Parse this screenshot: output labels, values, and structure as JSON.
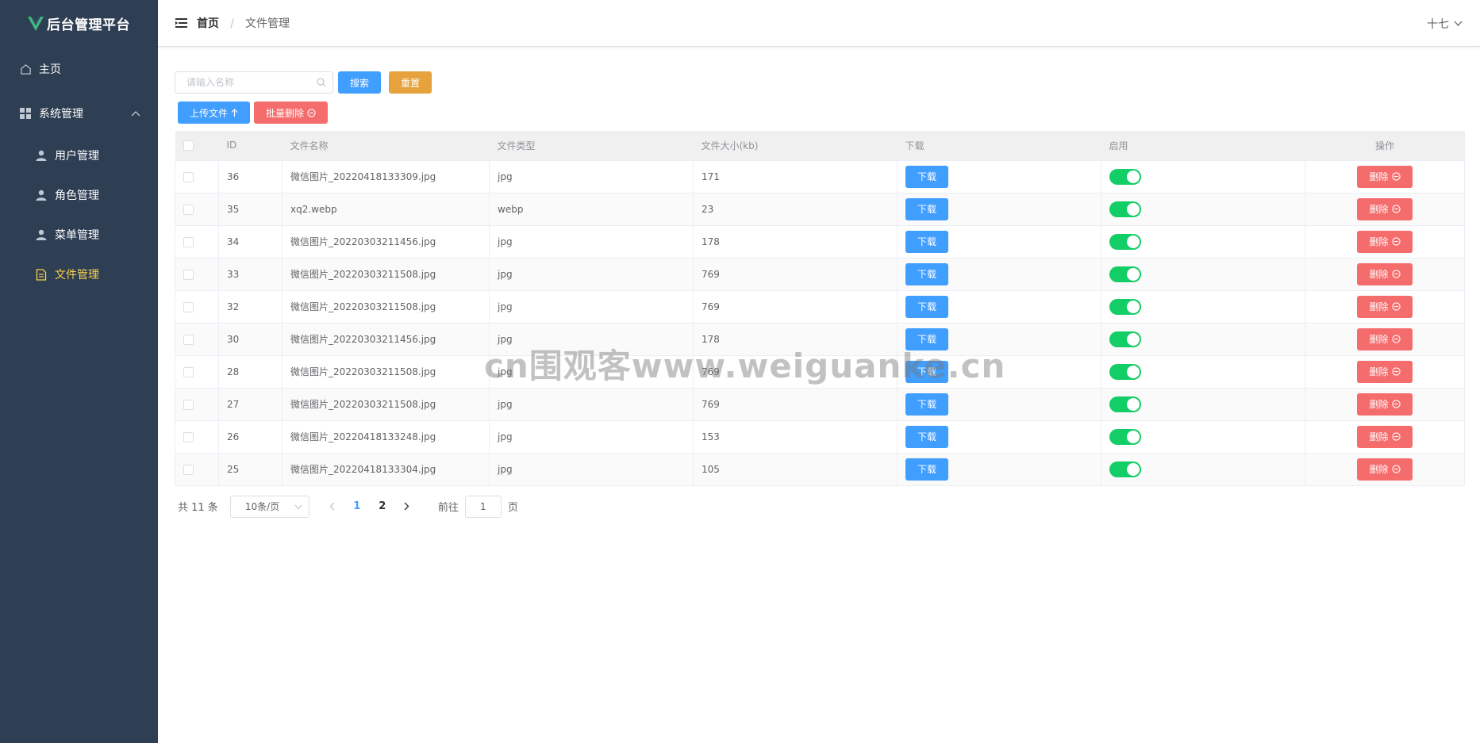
{
  "app": {
    "title": "后台管理平台"
  },
  "sidebar": {
    "items": [
      {
        "label": "主页",
        "icon": "home-icon"
      },
      {
        "label": "系统管理",
        "icon": "grid-icon",
        "expanded": true
      }
    ],
    "subitems": [
      {
        "label": "用户管理",
        "icon": "user-icon"
      },
      {
        "label": "角色管理",
        "icon": "user-icon"
      },
      {
        "label": "菜单管理",
        "icon": "user-icon"
      },
      {
        "label": "文件管理",
        "icon": "document-icon",
        "active": true
      }
    ]
  },
  "header": {
    "breadcrumb": {
      "home": "首页",
      "separator": "/",
      "current": "文件管理"
    },
    "user": "十七"
  },
  "toolbar": {
    "search_placeholder": "请输入名称",
    "search_label": "搜索",
    "reset_label": "重置",
    "upload_label": "上传文件",
    "batch_delete_label": "批量删除"
  },
  "table": {
    "columns": [
      "ID",
      "文件名称",
      "文件类型",
      "文件大小(kb)",
      "下载",
      "启用",
      "操作"
    ],
    "download_label": "下载",
    "delete_label": "删除",
    "rows": [
      {
        "id": "36",
        "name": "微信图片_20220418133309.jpg",
        "type": "jpg",
        "size": "171",
        "enabled": true
      },
      {
        "id": "35",
        "name": "xq2.webp",
        "type": "webp",
        "size": "23",
        "enabled": true
      },
      {
        "id": "34",
        "name": "微信图片_20220303211456.jpg",
        "type": "jpg",
        "size": "178",
        "enabled": true
      },
      {
        "id": "33",
        "name": "微信图片_20220303211508.jpg",
        "type": "jpg",
        "size": "769",
        "enabled": true
      },
      {
        "id": "32",
        "name": "微信图片_20220303211508.jpg",
        "type": "jpg",
        "size": "769",
        "enabled": true
      },
      {
        "id": "30",
        "name": "微信图片_20220303211456.jpg",
        "type": "jpg",
        "size": "178",
        "enabled": true
      },
      {
        "id": "28",
        "name": "微信图片_20220303211508.jpg",
        "type": "jpg",
        "size": "769",
        "enabled": true
      },
      {
        "id": "27",
        "name": "微信图片_20220303211508.jpg",
        "type": "jpg",
        "size": "769",
        "enabled": true
      },
      {
        "id": "26",
        "name": "微信图片_20220418133248.jpg",
        "type": "jpg",
        "size": "153",
        "enabled": true
      },
      {
        "id": "25",
        "name": "微信图片_20220418133304.jpg",
        "type": "jpg",
        "size": "105",
        "enabled": true
      }
    ]
  },
  "pagination": {
    "total": "共 11 条",
    "page_size": "10条/页",
    "pages": [
      "1",
      "2"
    ],
    "current_page": "1",
    "goto_prefix": "前往",
    "goto_value": "1",
    "goto_suffix": "页"
  },
  "watermark": "cn围观客www.weiguanke.cn",
  "colors": {
    "sidebar_bg": "#2e3e53",
    "active_menu": "#ffd04b",
    "primary": "#409eff",
    "warning": "#e6a23c",
    "danger": "#f56c6c",
    "switch_on": "#13ce66"
  }
}
